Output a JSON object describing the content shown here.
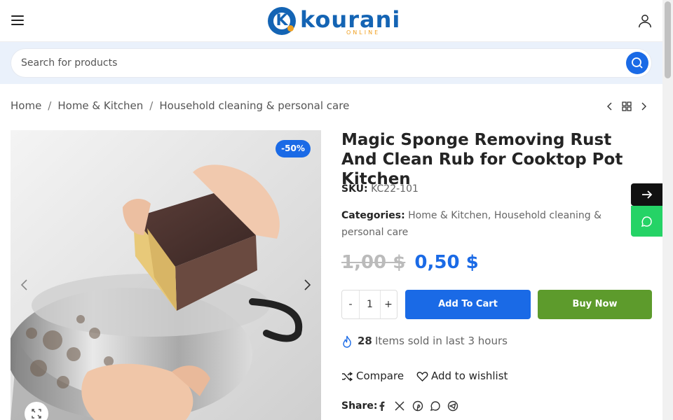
{
  "brand": {
    "name": "kourani",
    "tagline": "ONLINE",
    "primary_color": "#1464b4",
    "accent_color": "#f0a020"
  },
  "header": {
    "menu_icon": "hamburger-icon",
    "account_icon": "user-icon"
  },
  "search": {
    "placeholder": "Search for products",
    "value": "",
    "button_icon": "search-icon"
  },
  "breadcrumb": {
    "items": [
      "Home",
      "Home & Kitchen",
      "Household cleaning & personal care"
    ],
    "separator": "/"
  },
  "product_nav": {
    "prev_icon": "chevron-left-icon",
    "grid_icon": "grid-icon",
    "next_icon": "chevron-right-icon"
  },
  "gallery": {
    "badge": "-50%",
    "prev_icon": "chevron-left-icon",
    "next_icon": "chevron-right-icon",
    "zoom_icon": "expand-icon"
  },
  "product": {
    "title": "Magic Sponge Removing Rust And Clean Rub for Cooktop Pot Kitchen",
    "sku_label": "SKU:",
    "sku": "KC22-101",
    "categories_label": "Categories:",
    "categories": [
      "Home & Kitchen",
      "Household cleaning & personal care"
    ],
    "price_old": "1,00 $",
    "price_new": "0,50 $",
    "quantity": "1",
    "qty_minus": "-",
    "qty_plus": "+",
    "add_to_cart": "Add To Cart",
    "buy_now": "Buy Now",
    "sold_count": "28",
    "sold_text": "Items sold in last 3 hours",
    "compare": "Compare",
    "wishlist": "Add to wishlist",
    "share_label": "Share:",
    "share_icons": [
      "facebook-icon",
      "x-icon",
      "pinterest-icon",
      "whatsapp-icon",
      "telegram-icon"
    ]
  },
  "floating": {
    "next_icon": "arrow-right-icon",
    "whatsapp_icon": "whatsapp-icon"
  },
  "colors": {
    "primary_button": "#1a6ae6",
    "buy_button": "#5d9b2c",
    "whatsapp": "#25d366",
    "search_band": "#eaf1fb"
  }
}
